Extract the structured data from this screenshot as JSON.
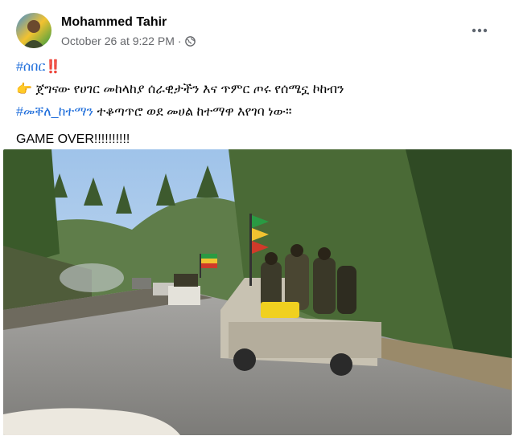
{
  "post": {
    "author": "Mohammed Tahir",
    "timestamp": "October 26 at 9:22 PM",
    "separator": "·",
    "privacy_icon": "globe-icon",
    "more_icon": "more-options-icon",
    "hashtag_top": "#ሰበር",
    "alert_emoji": "‼️",
    "pointing_emoji": "👉",
    "line2": "ጀግናው የሀገር መከላከያ ሰራዊታችን እና ጥምር ጦሩ የሰሜኗ ኮከብን",
    "hashtag_city": "#መቐለ_ከተማን",
    "line3_rest": " ተቆጣጥሮ ወደ መሀል ከተማዋ እየገባ ነው።",
    "line4": "GAME OVER!!!!!!!!!!"
  },
  "colors": {
    "hashtag": "#216fdb",
    "meta": "#65676b",
    "text": "#050505"
  }
}
